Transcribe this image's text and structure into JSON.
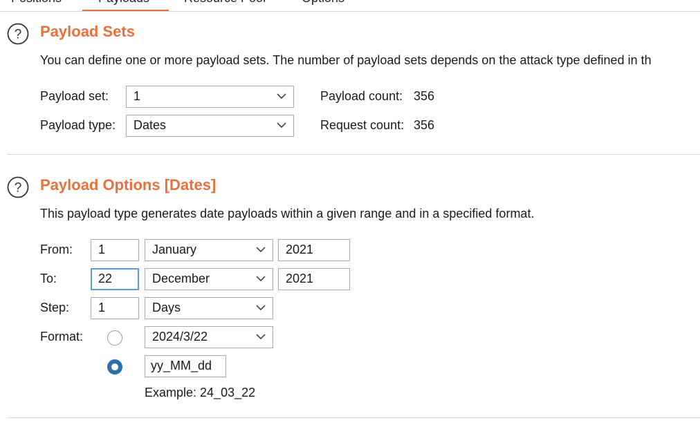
{
  "tabs": [
    "Positions",
    "Payloads",
    "Resource Pool",
    "Options"
  ],
  "payload_sets": {
    "title": "Payload Sets",
    "description": "You can define one or more payload sets. The number of payload sets depends on the attack type defined in th",
    "payload_set_label": "Payload set:",
    "payload_set_value": "1",
    "payload_type_label": "Payload type:",
    "payload_type_value": "Dates",
    "payload_count_label": "Payload count:",
    "payload_count_value": "356",
    "request_count_label": "Request count:",
    "request_count_value": "356"
  },
  "payload_options": {
    "title": "Payload Options [Dates]",
    "description": "This payload type generates date payloads within a given range and in a specified format.",
    "from_label": "From:",
    "from_day": "1",
    "from_month": "January",
    "from_year": "2021",
    "to_label": "To:",
    "to_day": "22",
    "to_month": "December",
    "to_year": "2021",
    "step_label": "Step:",
    "step_value": "1",
    "step_unit": "Days",
    "format_label": "Format:",
    "format_preset": "2024/3/22",
    "format_custom": "yy_MM_dd",
    "format_custom_selected": true,
    "example": "Example: 24_03_22"
  },
  "colors": {
    "accent": "#e8703a",
    "radio_selected": "#2e6fa8",
    "focus_border": "#5b9bd5"
  },
  "icons": [
    "help-icon",
    "chevron-down-icon"
  ]
}
